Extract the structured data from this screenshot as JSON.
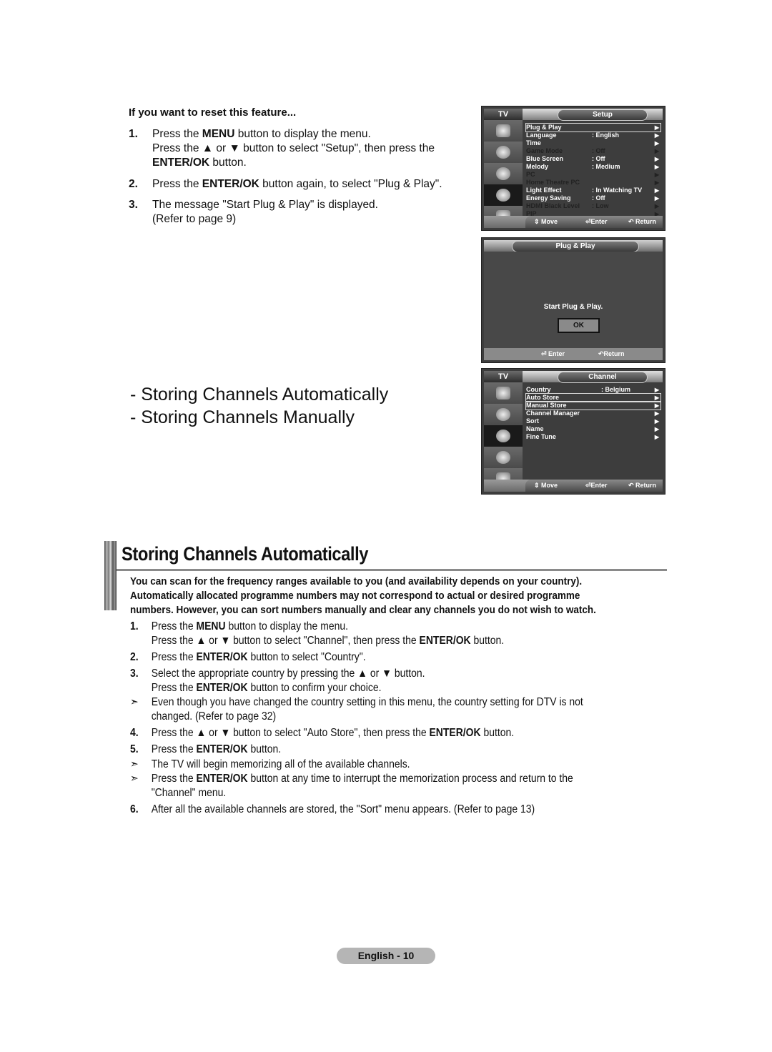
{
  "reset_section": {
    "heading": "If you want to reset this feature...",
    "steps": [
      {
        "num": "1.",
        "line1_pre": "Press the ",
        "line1_bold": "MENU",
        "line1_post": " button to display the menu.",
        "line2": "Press the ▲ or ▼ button to select \"Setup\", then press the",
        "line3_bold": "ENTER/OK",
        "line3_post": " button."
      },
      {
        "num": "2.",
        "pre": "Press the ",
        "bold": "ENTER/OK",
        "post": " button again, to select \"Plug & Play\"."
      },
      {
        "num": "3.",
        "line1": "The message \"Start Plug & Play\" is displayed.",
        "line2": "(Refer to page 9)"
      }
    ]
  },
  "topic_links": [
    "- Storing Channels Automatically",
    "- Storing Channels Manually"
  ],
  "setup_osd": {
    "tv_label": "TV",
    "title": "Setup",
    "rows": [
      {
        "label": "Plug & Play",
        "value": "",
        "arrow": "▶",
        "state": "selected"
      },
      {
        "label": "Language",
        "value": ": English",
        "arrow": "▶",
        "state": "normal"
      },
      {
        "label": "Time",
        "value": "",
        "arrow": "▶",
        "state": "normal"
      },
      {
        "label": "Game Mode",
        "value": ": Off",
        "arrow": "▶",
        "state": "disabled"
      },
      {
        "label": "Blue Screen",
        "value": ": Off",
        "arrow": "▶",
        "state": "normal"
      },
      {
        "label": "Melody",
        "value": ": Medium",
        "arrow": "▶",
        "state": "normal"
      },
      {
        "label": "PC",
        "value": "",
        "arrow": "▶",
        "state": "disabled"
      },
      {
        "label": "Home Theatre PC",
        "value": "",
        "arrow": "▶",
        "state": "disabled"
      },
      {
        "label": "Light Effect",
        "value": ": In Watching TV",
        "arrow": "▶",
        "state": "normal"
      },
      {
        "label": "Energy Saving",
        "value": ": Off",
        "arrow": "▶",
        "state": "normal"
      },
      {
        "label": "HDMI Black Level",
        "value": ": Low",
        "arrow": "▶",
        "state": "disabled"
      },
      {
        "label": "PIP",
        "value": "",
        "arrow": "▶",
        "state": "disabled"
      }
    ],
    "footer": {
      "move": "⇕ Move",
      "enter": "⏎Enter",
      "return": "↶ Return"
    }
  },
  "plugplay_osd": {
    "title": "Plug & Play",
    "message": "Start Plug & Play.",
    "ok_label": "OK",
    "footer": {
      "enter": "⏎ Enter",
      "return": "↶Return"
    }
  },
  "channel_osd": {
    "tv_label": "TV",
    "title": "Channel",
    "rows": [
      {
        "label": "Country",
        "value": ": Belgium",
        "arrow": "▶",
        "state": "normal"
      },
      {
        "label": "Auto Store",
        "value": "",
        "arrow": "▶",
        "state": "selected"
      },
      {
        "label": "Manual Store",
        "value": "",
        "arrow": "▶",
        "state": "selected"
      },
      {
        "label": "Channel Manager",
        "value": "",
        "arrow": "▶",
        "state": "normal"
      },
      {
        "label": "Sort",
        "value": "",
        "arrow": "▶",
        "state": "normal"
      },
      {
        "label": "Name",
        "value": "",
        "arrow": "▶",
        "state": "normal"
      },
      {
        "label": "Fine Tune",
        "value": "",
        "arrow": "▶",
        "state": "normal"
      }
    ],
    "footer": {
      "move": "⇕ Move",
      "enter": "⏎Enter",
      "return": "↶ Return"
    }
  },
  "section": {
    "title": "Storing Channels Automatically",
    "intro": [
      "You can scan for the frequency ranges available to you (and availability depends on your country).",
      "Automatically allocated programme numbers may not correspond to actual or desired programme",
      "numbers. However, you can sort numbers manually and clear any channels you do not wish to watch."
    ],
    "items": [
      {
        "marker": "1.",
        "parts": [
          [
            "Press the ",
            ""
          ],
          [
            "MENU",
            "b"
          ],
          [
            " button to display the menu.",
            ""
          ]
        ]
      },
      {
        "marker": "",
        "parts": [
          [
            "Press the ▲ or ▼ button to select \"Channel\", then press the ",
            ""
          ],
          [
            "ENTER/OK",
            "b"
          ],
          [
            " button.",
            ""
          ]
        ]
      },
      {
        "marker": "2.",
        "parts": [
          [
            "Press the ",
            ""
          ],
          [
            "ENTER/OK",
            "b"
          ],
          [
            " button to select \"Country\".",
            ""
          ]
        ]
      },
      {
        "marker": "3.",
        "parts": [
          [
            "Select the appropriate country by pressing the ▲ or ▼ button.",
            ""
          ]
        ]
      },
      {
        "marker": "",
        "parts": [
          [
            "Press the ",
            ""
          ],
          [
            "ENTER/OK",
            "b"
          ],
          [
            " button to confirm your choice.",
            ""
          ]
        ]
      },
      {
        "marker": "➣",
        "parts": [
          [
            "Even though you have changed the country setting in this menu, the country setting for DTV is not",
            ""
          ]
        ]
      },
      {
        "marker": "",
        "parts": [
          [
            "changed. (Refer to page 32)",
            ""
          ]
        ]
      },
      {
        "marker": "4.",
        "parts": [
          [
            "Press the ▲ or ▼ button to select \"Auto Store\", then press the ",
            ""
          ],
          [
            "ENTER/OK",
            "b"
          ],
          [
            " button.",
            ""
          ]
        ]
      },
      {
        "marker": "5.",
        "parts": [
          [
            "Press the ",
            ""
          ],
          [
            "ENTER/OK",
            "b"
          ],
          [
            " button.",
            ""
          ]
        ]
      },
      {
        "marker": "➣",
        "parts": [
          [
            "The TV will begin memorizing all of the available channels.",
            ""
          ]
        ]
      },
      {
        "marker": "➣",
        "parts": [
          [
            "Press the ",
            ""
          ],
          [
            "ENTER/OK",
            "b"
          ],
          [
            " button at any time to interrupt the memorization process and return to the",
            ""
          ]
        ]
      },
      {
        "marker": "",
        "parts": [
          [
            "\"Channel\" menu.",
            ""
          ]
        ]
      },
      {
        "marker": "6.",
        "parts": [
          [
            "After all the available channels are stored, the \"Sort\" menu appears. (Refer to page 13)",
            ""
          ]
        ]
      }
    ]
  },
  "page_label": "English - 10"
}
